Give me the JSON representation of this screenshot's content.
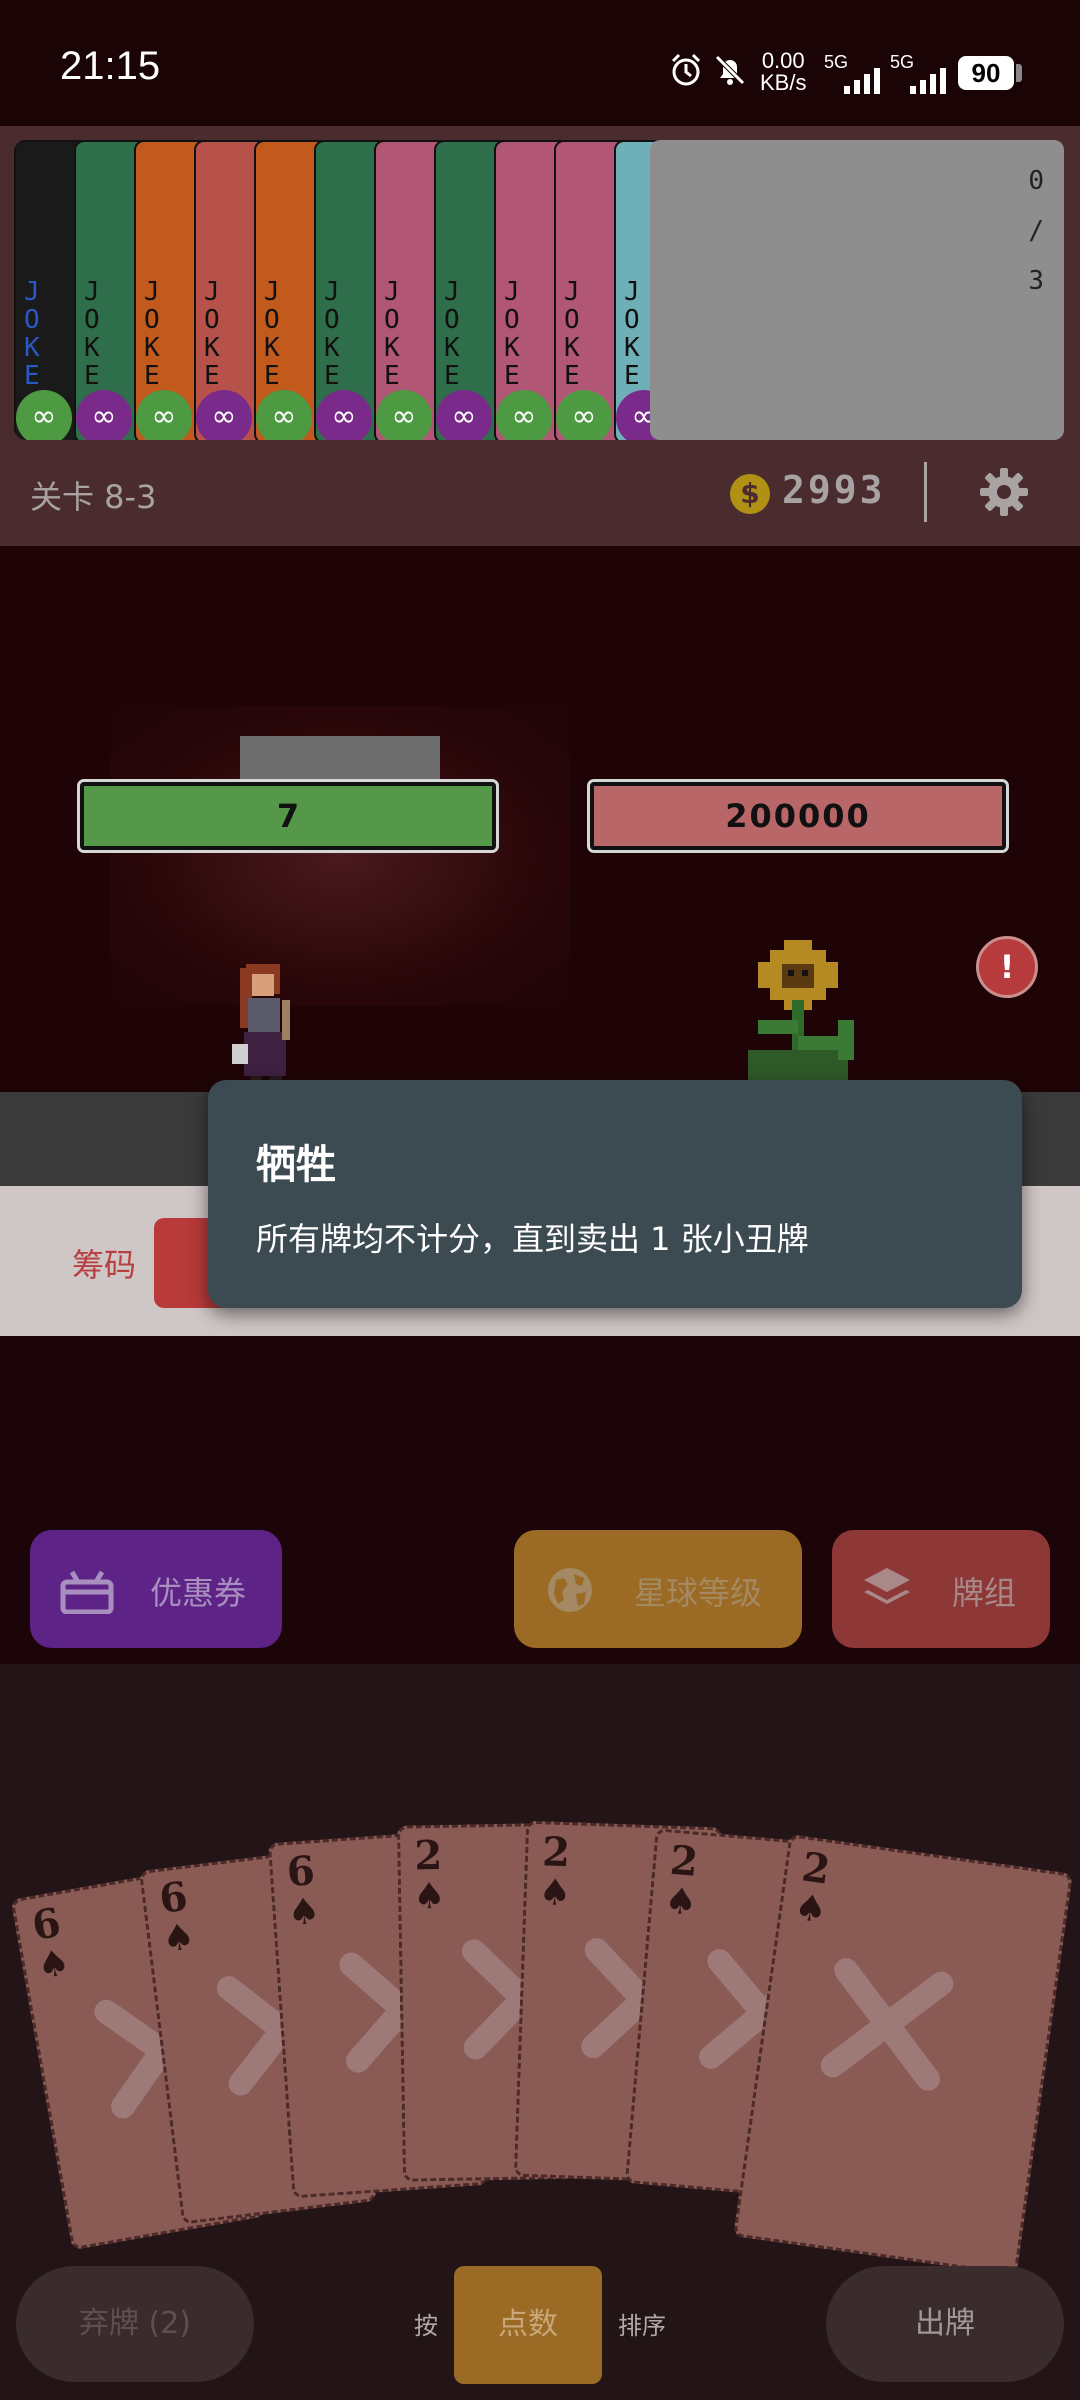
{
  "status_bar": {
    "time": "21:15",
    "net_speed_value": "0.00",
    "net_speed_unit": "KB/s",
    "sim1_label": "5G",
    "sim2_label": "5G",
    "battery": "90",
    "icons": [
      "alarm-icon",
      "mute-icon"
    ]
  },
  "jokers": {
    "card_text": "J\nO\nK\nE",
    "infinity": "∞",
    "colors": [
      "#1a1a1a",
      "#2f6e4a",
      "#c25a1e",
      "#b7524a",
      "#c25a1e",
      "#2f6e4a",
      "#b25676",
      "#2f6e4a",
      "#b25676",
      "#b25676",
      "#6fb0b8"
    ],
    "badge_colors": [
      "#4e9a43",
      "#7a2a8a",
      "#4e9a43",
      "#7a2a8a",
      "#4e9a43",
      "#7a2a8a",
      "#4e9a43",
      "#7a2a8a",
      "#4e9a43",
      "#4e9a43",
      "#7a2a8a"
    ],
    "count_current": "0",
    "count_sep": "/",
    "count_max": "3"
  },
  "header": {
    "stage": "关卡 8-3",
    "coin_symbol": "$",
    "money": "2993"
  },
  "battle": {
    "player_value": "7",
    "enemy_value": "200000",
    "alert": "!"
  },
  "chips": {
    "label": "筹码"
  },
  "tooltip": {
    "title": "牺牲",
    "description": "所有牌均不计分，直到卖出 1 张小丑牌"
  },
  "buttons": {
    "coupon": "优惠券",
    "planet_level": "星球等级",
    "deck": "牌组"
  },
  "hand": [
    {
      "rank": "6",
      "suit": "♠"
    },
    {
      "rank": "6",
      "suit": "♠"
    },
    {
      "rank": "6",
      "suit": "♠"
    },
    {
      "rank": "2",
      "suit": "♠"
    },
    {
      "rank": "2",
      "suit": "♠"
    },
    {
      "rank": "2",
      "suit": "♠"
    },
    {
      "rank": "2",
      "suit": "♠"
    }
  ],
  "controls": {
    "discard": "弃牌 (2)",
    "sort_prefix": "按",
    "sort_by": "点数",
    "sort_suffix": "排序",
    "play": "出牌"
  }
}
